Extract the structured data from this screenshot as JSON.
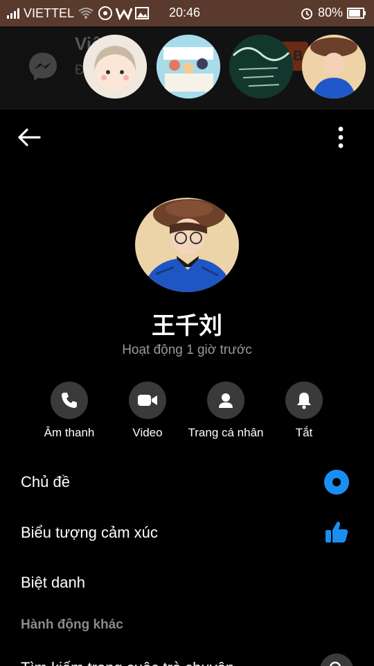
{
  "status_bar": {
    "carrier": "VIETTEL",
    "time": "20:46",
    "battery": "80%"
  },
  "bg_chat": {
    "name_partial": "Việ",
    "sub_partial": "Đ",
    "badge_partial": "B"
  },
  "profile": {
    "name": "王千刘",
    "status": "Hoạt động 1 giờ trước"
  },
  "actions": {
    "audio": "Âm thanh",
    "video": "Video",
    "profile": "Trang cá nhân",
    "mute": "Tắt"
  },
  "settings": {
    "theme": "Chủ đề",
    "emoji": "Biểu tượng cảm xúc",
    "nickname": "Biệt danh",
    "more_actions": "Hành động khác",
    "search_partial": "Tìm kiếm trong cuộc trò chuyện"
  },
  "colors": {
    "accent": "#1b8ef2",
    "statusbar": "#5a3a2c",
    "circle_bg": "#3a3a3a"
  },
  "icons": [
    "back-arrow-icon",
    "more-vert-icon",
    "phone-icon",
    "video-camera-icon",
    "person-icon",
    "bell-icon",
    "theme-dot-icon",
    "thumbs-up-icon",
    "search-icon",
    "messenger-icon"
  ]
}
